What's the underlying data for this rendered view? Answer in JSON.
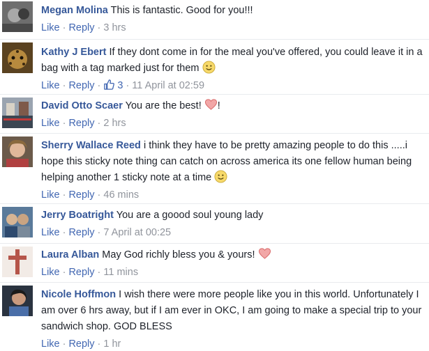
{
  "comments": [
    {
      "name": "Megan Molina",
      "text": "This is fantastic. Good for you!!!",
      "like": "Like",
      "reply": "Reply",
      "time": "3 hrs",
      "emoji": null
    },
    {
      "name": "Kathy J Ebert",
      "text": "If they dont come in for the meal you've offered, you could leave it in a bag with a tag marked just for them",
      "like": "Like",
      "reply": "Reply",
      "likes": "3",
      "time": "11 April at 02:59",
      "emoji": "smile-emoji"
    },
    {
      "name": "David Otto Scaer",
      "text": "You are the best!",
      "text_after": "!",
      "like": "Like",
      "reply": "Reply",
      "time": "2 hrs",
      "emoji": "heart-emoji"
    },
    {
      "name": "Sherry Wallace Reed",
      "text": "i think they have to be pretty amazing people to do this .....i hope this sticky note thing can catch on across america its one fellow human being helping another 1 sticky note at a time",
      "like": "Like",
      "reply": "Reply",
      "time": "46 mins",
      "emoji": "smile-emoji"
    },
    {
      "name": "Jerry Boatright",
      "text": "You are a goood soul young lady",
      "like": "Like",
      "reply": "Reply",
      "time": "7 April at 00:25",
      "emoji": null
    },
    {
      "name": "Laura Alban",
      "text": "May God richly bless you & yours!",
      "like": "Like",
      "reply": "Reply",
      "time": "11 mins",
      "emoji": "heart-emoji"
    },
    {
      "name": "Nicole Hoffmon",
      "text": "I wish there were more people like you in this world. Unfortunately I am over 6 hrs away, but if I am ever in OKC, I am going to make a special trip to your sandwich shop. GOD BLESS",
      "like": "Like",
      "reply": "Reply",
      "time": "1 hr",
      "emoji": null
    }
  ],
  "colors": {
    "name": "#365899",
    "link": "#4267b2",
    "meta": "#90949c",
    "text": "#1d2129"
  }
}
